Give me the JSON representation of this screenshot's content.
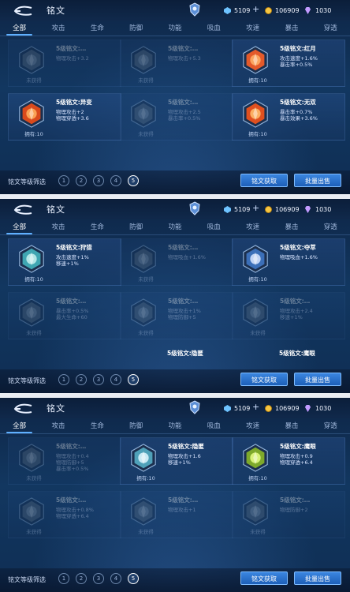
{
  "header": {
    "title": "铭文",
    "currency": [
      {
        "icon": "blue-crystal-icon",
        "value": "5109"
      },
      {
        "icon": "gold-coin-icon",
        "value": "106909"
      },
      {
        "icon": "purple-diamond-icon",
        "value": "1030"
      }
    ],
    "plus": "+"
  },
  "tabs": [
    "全部",
    "攻击",
    "生命",
    "防御",
    "功能",
    "吸血",
    "攻速",
    "暴击",
    "穿透"
  ],
  "footer": {
    "filter_label": "铭文等级筛选",
    "levels": [
      "1",
      "2",
      "3",
      "4",
      "5"
    ],
    "obtain_button": "铭文获取",
    "sell_button": "批量出售"
  },
  "screens": [
    {
      "cards": [
        {
          "name": "5级铭文:…",
          "stats": [
            "物理攻击+3.2"
          ],
          "owned": "未获得",
          "dim": true,
          "icon": "inscription-gray-icon"
        },
        {
          "name": "5级铭文:…",
          "stats": [
            "物理攻击+5.3"
          ],
          "owned": "未获得",
          "dim": true,
          "icon": "inscription-gray-icon"
        },
        {
          "name": "5级铭文:红月",
          "stats": [
            "攻击速度+1.6%",
            "暴击率+0.5%"
          ],
          "owned": "拥有:10",
          "dim": false,
          "icon": "red-moon-inscription-icon"
        },
        {
          "name": "5级铭文:异变",
          "stats": [
            "物理攻击+2",
            "物理穿透+3.6"
          ],
          "owned": "拥有:10",
          "dim": false,
          "icon": "mutation-inscription-icon"
        },
        {
          "name": "5级铭文:…",
          "stats": [
            "物理攻击+2.5",
            "暴击率+0.5%"
          ],
          "owned": "未获得",
          "dim": true,
          "icon": "inscription-gray-icon"
        },
        {
          "name": "5级铭文:无双",
          "stats": [
            "暴击率+0.7%",
            "暴击效果+3.6%"
          ],
          "owned": "拥有:10",
          "dim": false,
          "icon": "peerless-inscription-icon"
        }
      ]
    },
    {
      "cards": [
        {
          "name": "5级铭文:狩猎",
          "stats": [
            "攻击速度+1%",
            "移速+1%"
          ],
          "owned": "拥有:10",
          "dim": false,
          "icon": "hunt-inscription-icon"
        },
        {
          "name": "5级铭文:…",
          "stats": [
            "物理吸血+1.6%"
          ],
          "owned": "未获得",
          "dim": true,
          "icon": "inscription-gray-icon"
        },
        {
          "name": "5级铭文:夺萃",
          "stats": [
            "物理吸血+1.6%"
          ],
          "owned": "拥有:10",
          "dim": false,
          "icon": "seize-inscription-icon"
        },
        {
          "name": "5级铭文:…",
          "stats": [
            "暴击率+0.5%",
            "最大生命+60"
          ],
          "owned": "未获得",
          "dim": true,
          "icon": "inscription-gray-icon"
        },
        {
          "name": "5级铭文:…",
          "stats": [
            "物理攻击+1%",
            "物理防御+5"
          ],
          "owned": "未获得",
          "dim": true,
          "icon": "inscription-gray-icon"
        },
        {
          "name": "5级铭文:…",
          "stats": [
            "物理攻击+2.4",
            "移速+1%"
          ],
          "owned": "未获得",
          "dim": true,
          "icon": "inscription-gray-icon"
        }
      ],
      "peek": [
        "5级铭文:隐匿",
        "5级铭文:鹰眼"
      ]
    },
    {
      "cards": [
        {
          "name": "5级铭文:…",
          "stats": [
            "物理攻击+0.4",
            "物理防御+5",
            "暴击率+0.5%"
          ],
          "owned": "未获得",
          "dim": true,
          "icon": "inscription-gray-icon"
        },
        {
          "name": "5级铭文:隐匿",
          "stats": [
            "物理攻击+1.6",
            "移速+1%"
          ],
          "owned": "拥有:10",
          "dim": false,
          "icon": "stealth-inscription-icon"
        },
        {
          "name": "5级铭文:鹰眼",
          "stats": [
            "物理攻击+0.9",
            "物理穿透+6.4"
          ],
          "owned": "拥有:10",
          "dim": false,
          "icon": "eagle-eye-inscription-icon"
        },
        {
          "name": "5级铭文:…",
          "stats": [
            "物理攻击+0.8%",
            "物理穿透+6.4"
          ],
          "owned": "未获得",
          "dim": true,
          "icon": "inscription-gray-icon"
        },
        {
          "name": "5级铭文:…",
          "stats": [
            "物理攻击+1"
          ],
          "owned": "未获得",
          "dim": true,
          "icon": "inscription-gray-icon"
        },
        {
          "name": "5级铭文:…",
          "stats": [
            "物理防御+2"
          ],
          "owned": "未获得",
          "dim": true,
          "icon": "inscription-gray-icon"
        }
      ]
    }
  ]
}
